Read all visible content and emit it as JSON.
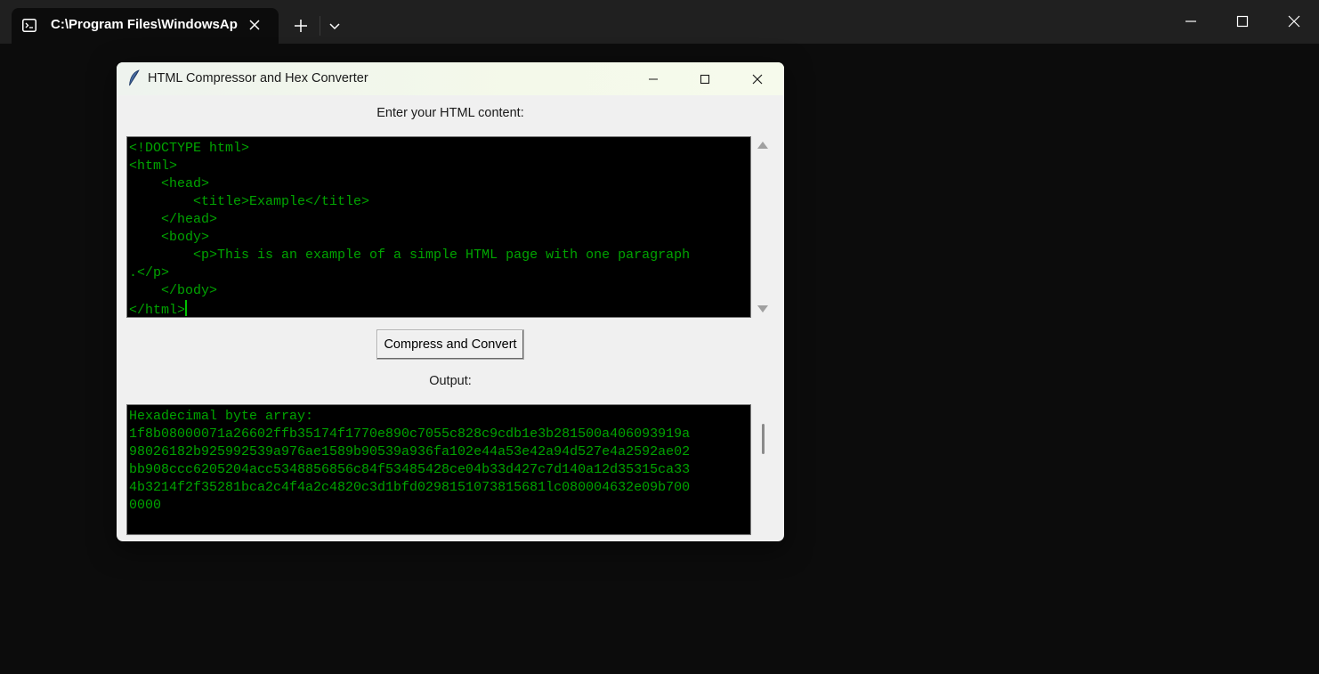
{
  "terminal": {
    "tab_title": "C:\\Program Files\\WindowsAp",
    "icons": {
      "tab": "terminal-icon",
      "close": "close-icon",
      "new_tab": "plus-icon",
      "dropdown": "chevron-down-icon",
      "minimize": "minimize-icon",
      "maximize": "maximize-icon",
      "window_close": "close-icon"
    }
  },
  "app": {
    "title": "HTML Compressor and Hex Converter",
    "input_label": "Enter your HTML content:",
    "input_lines": [
      "<!DOCTYPE html>",
      "<html>",
      "    <head>",
      "        <title>Example</title>",
      "    </head>",
      "    <body>",
      "        <p>This is an example of a simple HTML page with one paragraph",
      ".</p>",
      "    </body>",
      "</html>"
    ],
    "button_label": "Compress and Convert",
    "output_label": "Output:",
    "output_lines": [
      "Hexadecimal byte array:",
      "1f8b08000071a26602ffb35174f1770e890c7055c828c9cdb1e3b281500a406093919a",
      "98026182b925992539a976ae1589b90539a936fa102e44a53e42a94d527e4a2592ae02",
      "bb908ccc6205204acc5348856856c84f53485428ce04b33d427c7d140a12d35315ca33",
      "4b3214f2f35281bca2c4f4a2c4820c3d1bfd0298151073815681lc080004632e09b700",
      "0000"
    ],
    "colors": {
      "code_text": "#00a400",
      "code_bg": "#000000",
      "window_bg": "#f0f0f0"
    },
    "icons": {
      "app": "feather-icon",
      "minimize": "minimize-icon",
      "maximize": "maximize-icon",
      "close": "close-icon"
    }
  }
}
